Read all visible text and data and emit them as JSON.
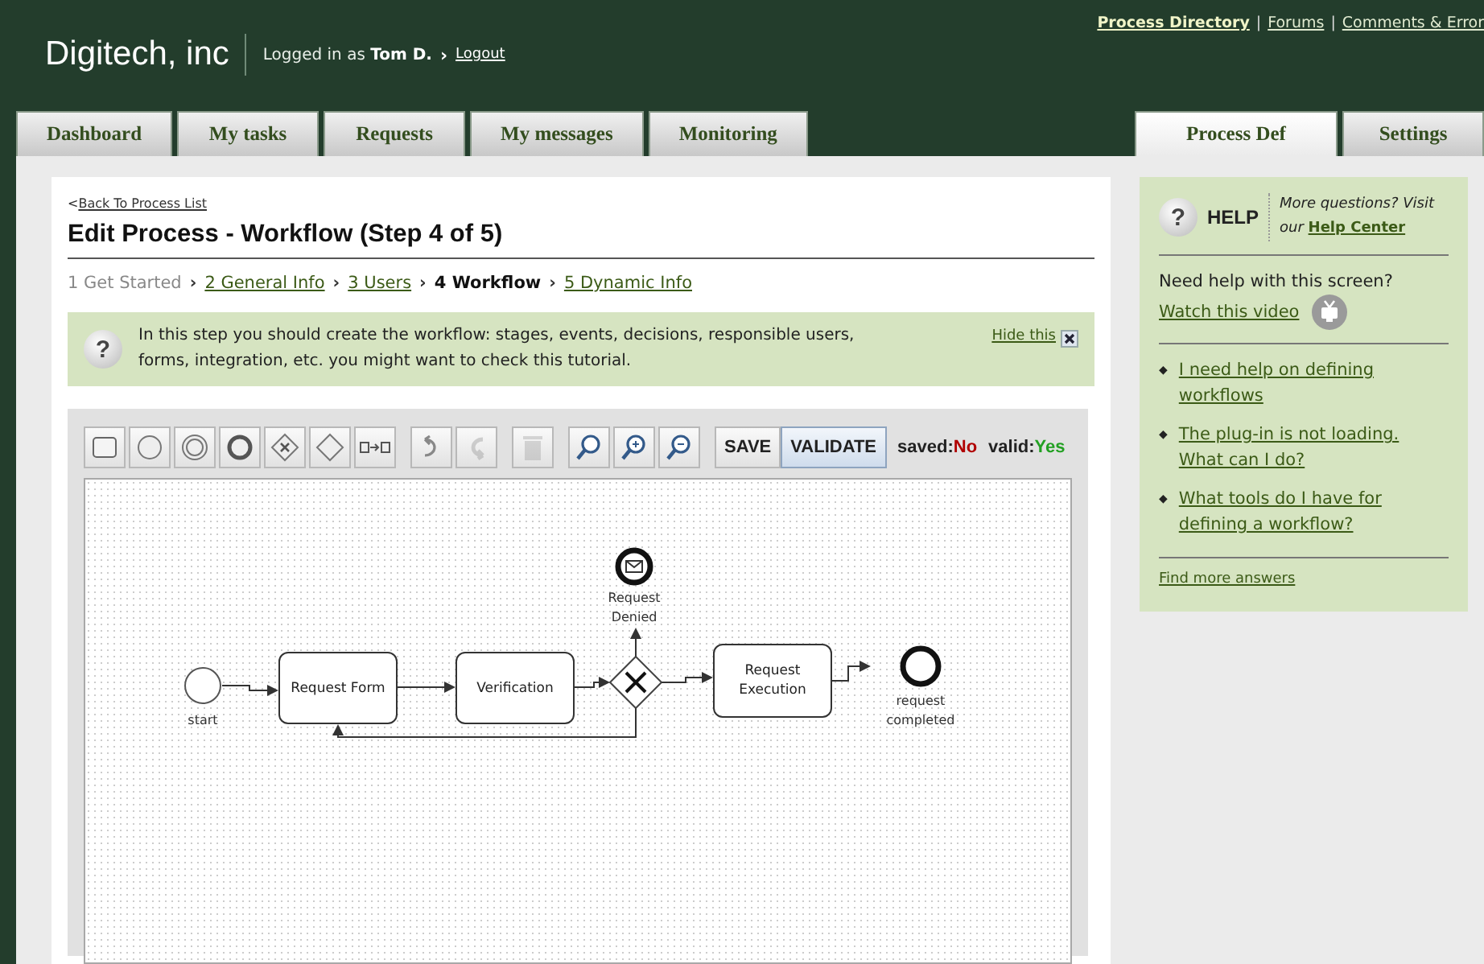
{
  "header": {
    "logo": "Digitech, inc",
    "logged_in_prefix": "Logged in as",
    "user": "Tom D.",
    "arrow": "›",
    "logout": "Logout",
    "links": [
      {
        "label": "Process Directory",
        "bold": true
      },
      {
        "label": "Forums",
        "bold": false
      },
      {
        "label": "Comments & Error",
        "bold": false
      }
    ],
    "separator": "|"
  },
  "tabs_left": [
    {
      "label": "Dashboard",
      "selected": false
    },
    {
      "label": "My tasks",
      "selected": false
    },
    {
      "label": "Requests",
      "selected": false
    },
    {
      "label": "My messages",
      "selected": false
    },
    {
      "label": "Monitoring",
      "selected": false
    }
  ],
  "tabs_right": [
    {
      "label": "Process Def",
      "selected": true
    },
    {
      "label": "Settings",
      "selected": false
    }
  ],
  "back_link": {
    "prefix": "<",
    "label": "Back To Process List"
  },
  "title": "Edit Process - Workflow (Step 4 of 5)",
  "steps": [
    {
      "label": "1 Get Started",
      "kind": "plain"
    },
    {
      "sep": "›",
      "label": "2 General Info",
      "kind": "link"
    },
    {
      "sep": "›",
      "label": "3 Users",
      "kind": "link"
    },
    {
      "sep": "›",
      "label": "4 Workflow",
      "kind": "current"
    },
    {
      "sep": "›",
      "label": "5 Dynamic Info",
      "kind": "link"
    }
  ],
  "info": {
    "icon": "?",
    "text": "In this step you should create the workflow: stages, events, decisions, responsible users, forms, integration, etc. you might want to check this tutorial.",
    "hide": "Hide this"
  },
  "toolbar": {
    "tools": [
      {
        "kind": "task",
        "disabled": false
      },
      {
        "kind": "start",
        "disabled": false
      },
      {
        "kind": "intermediate",
        "disabled": false
      },
      {
        "kind": "end",
        "disabled": false
      },
      {
        "kind": "gateway-x",
        "disabled": false
      },
      {
        "kind": "gateway",
        "disabled": false
      },
      {
        "kind": "connector",
        "disabled": false
      },
      {
        "kind": "undo",
        "disabled": false
      },
      {
        "kind": "redo",
        "disabled": true
      },
      {
        "kind": "delete",
        "disabled": true
      },
      {
        "kind": "search",
        "disabled": false
      },
      {
        "kind": "zoom-in",
        "disabled": false
      },
      {
        "kind": "zoom-out",
        "disabled": false
      }
    ],
    "buttons": [
      {
        "label": "SAVE",
        "selected": false
      },
      {
        "label": "VALIDATE",
        "selected": true
      }
    ],
    "status": [
      {
        "label": "saved:",
        "value": "No",
        "color": "#b00000"
      },
      {
        "label": "valid:",
        "value": "Yes",
        "color": "#22a022"
      }
    ]
  },
  "diagram": {
    "nodes": [
      {
        "kind": "start",
        "label": "start"
      },
      {
        "kind": "task",
        "label": "Request Form"
      },
      {
        "kind": "task",
        "label": "Verification"
      },
      {
        "kind": "gateway"
      },
      {
        "kind": "message-end",
        "label": "Request Denied"
      },
      {
        "kind": "task",
        "label": "Request Execution"
      },
      {
        "kind": "end",
        "label": "request completed"
      }
    ]
  },
  "help": {
    "icon": "?",
    "title": "HELP",
    "more_prefix": "More questions? Visit our",
    "help_center": "Help Center",
    "need": "Need help with this screen?",
    "video": "Watch this video",
    "items": [
      "I need help on defining workflows",
      "The plug-in is not loading. What can I do?",
      "What tools do I have for defining a workflow?"
    ],
    "bullet": "◆",
    "find_more": "Find more answers"
  }
}
